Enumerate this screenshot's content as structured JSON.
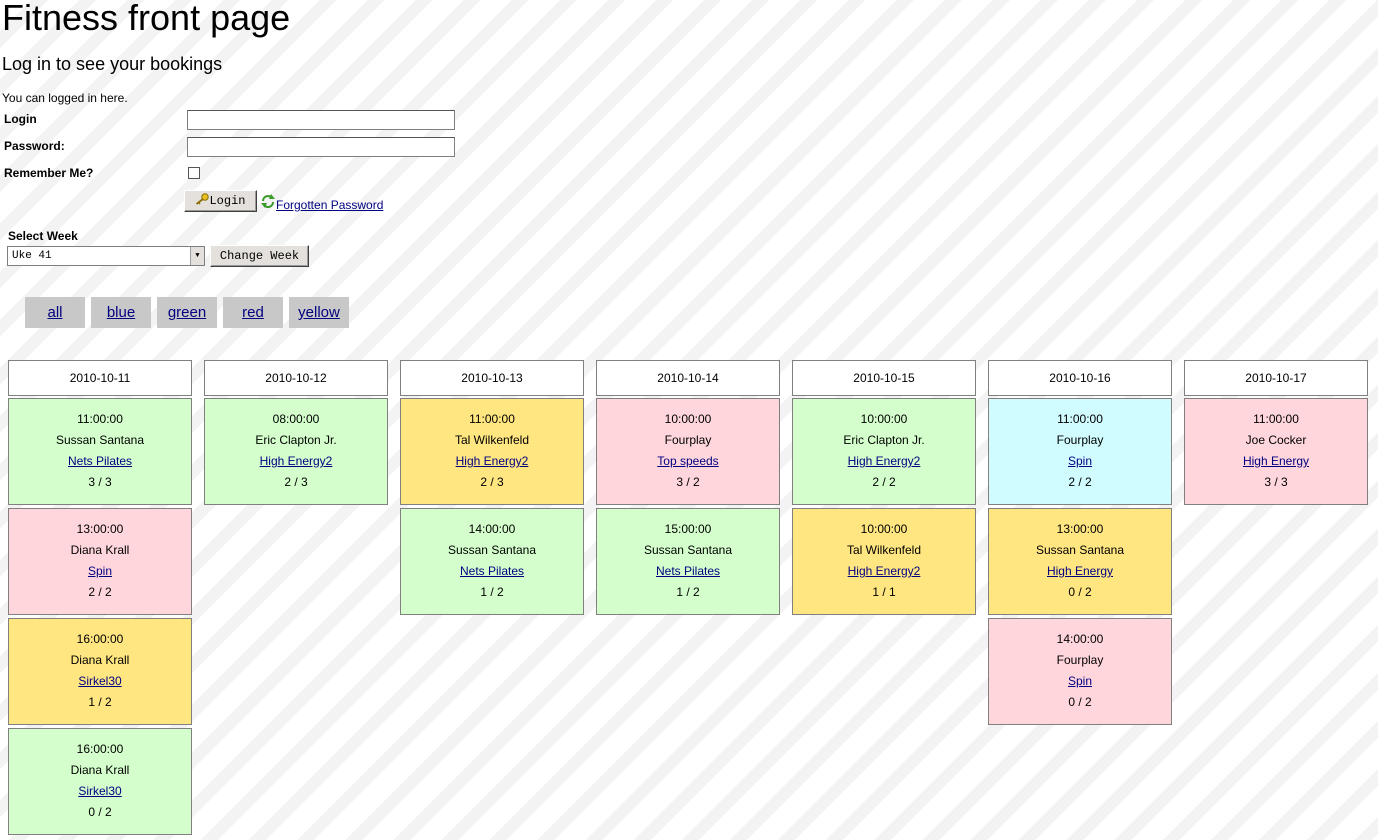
{
  "page": {
    "title": "Fitness front page",
    "subtitle": "Log in to see your bookings",
    "intro": "You can logged in here."
  },
  "login_form": {
    "login_label": "Login",
    "password_label": "Password:",
    "remember_label": "Remember Me?",
    "login_value": "",
    "password_value": "",
    "remember_checked": false,
    "login_button": "Login",
    "forgot_link": "Forgotten Password"
  },
  "week_selector": {
    "label": "Select Week",
    "selected": "Uke 41",
    "change_button": "Change Week"
  },
  "filters": [
    "all",
    "blue",
    "green",
    "red",
    "yellow"
  ],
  "colors": {
    "green": "#d4ffcc",
    "red": "#ffd6dc",
    "yellow": "#ffe680",
    "blue": "#d0fbff",
    "filter_bg": "#c8c8c8",
    "link": "#000080"
  },
  "days": [
    {
      "date": "2010-10-11",
      "sessions": [
        {
          "time": "11:00:00",
          "instructor": "Sussan Santana",
          "class": "Nets Pilates",
          "count": "3 / 3",
          "color": "green"
        },
        {
          "time": "13:00:00",
          "instructor": "Diana Krall",
          "class": "Spin",
          "count": "2 / 2",
          "color": "red"
        },
        {
          "time": "16:00:00",
          "instructor": "Diana Krall",
          "class": "Sirkel30",
          "count": "1 / 2",
          "color": "yellow"
        },
        {
          "time": "16:00:00",
          "instructor": "Diana Krall",
          "class": "Sirkel30",
          "count": "0 / 2",
          "color": "green"
        }
      ]
    },
    {
      "date": "2010-10-12",
      "sessions": [
        {
          "time": "08:00:00",
          "instructor": "Eric Clapton Jr.",
          "class": "High Energy2",
          "count": "2 / 3",
          "color": "green"
        }
      ]
    },
    {
      "date": "2010-10-13",
      "sessions": [
        {
          "time": "11:00:00",
          "instructor": "Tal Wilkenfeld",
          "class": "High Energy2",
          "count": "2 / 3",
          "color": "yellow"
        },
        {
          "time": "14:00:00",
          "instructor": "Sussan Santana",
          "class": "Nets Pilates",
          "count": "1 / 2",
          "color": "green"
        }
      ]
    },
    {
      "date": "2010-10-14",
      "sessions": [
        {
          "time": "10:00:00",
          "instructor": "Fourplay",
          "class": "Top speeds",
          "count": "3 / 2",
          "color": "red"
        },
        {
          "time": "15:00:00",
          "instructor": "Sussan Santana",
          "class": "Nets Pilates",
          "count": "1 / 2",
          "color": "green"
        }
      ]
    },
    {
      "date": "2010-10-15",
      "sessions": [
        {
          "time": "10:00:00",
          "instructor": "Eric Clapton Jr.",
          "class": "High Energy2",
          "count": "2 / 2",
          "color": "green"
        },
        {
          "time": "10:00:00",
          "instructor": "Tal Wilkenfeld",
          "class": "High Energy2",
          "count": "1 / 1",
          "color": "yellow"
        }
      ]
    },
    {
      "date": "2010-10-16",
      "sessions": [
        {
          "time": "11:00:00",
          "instructor": "Fourplay",
          "class": "Spin",
          "count": "2 / 2",
          "color": "blue"
        },
        {
          "time": "13:00:00",
          "instructor": "Sussan Santana",
          "class": "High Energy",
          "count": "0 / 2",
          "color": "yellow"
        },
        {
          "time": "14:00:00",
          "instructor": "Fourplay",
          "class": "Spin",
          "count": "0 / 2",
          "color": "red"
        }
      ]
    },
    {
      "date": "2010-10-17",
      "sessions": [
        {
          "time": "11:00:00",
          "instructor": "Joe Cocker",
          "class": "High Energy",
          "count": "3 / 3",
          "color": "red"
        }
      ]
    }
  ]
}
